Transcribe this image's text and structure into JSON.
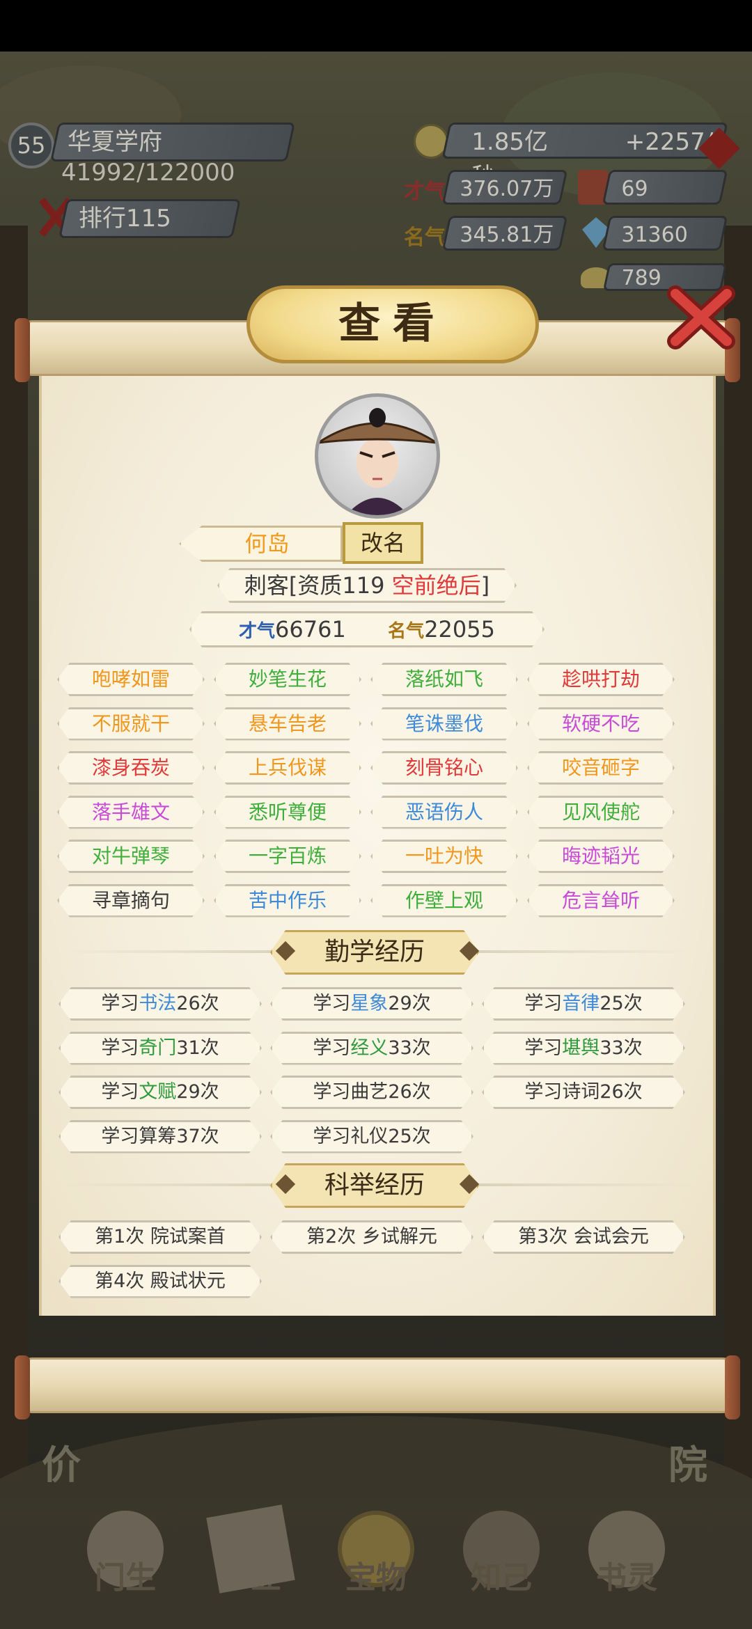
{
  "hud": {
    "level": "55",
    "academy_name": "华夏学府",
    "exp": "41992/122000",
    "rank_label": "排行",
    "rank_value": "115",
    "gold": "1.85亿",
    "gold_rate": "+2257/秒",
    "talent_label": "才气",
    "talent_value": "376.07万",
    "books_value": "69",
    "fame_label": "名气",
    "fame_value": "345.81万",
    "gem_value": "31360",
    "ingot_value": "789",
    "side_left": "价",
    "side_right": "院"
  },
  "dialog": {
    "title": "查看",
    "character": {
      "name": "何岛",
      "rename_label": "改名",
      "profession_prefix": "刺客[资质119 ",
      "grade": "空前绝后",
      "profession_suffix": "]",
      "talent_icon": "才气",
      "talent": "66761",
      "fame_icon": "名气",
      "fame": "22055"
    },
    "traits": [
      {
        "label": "咆哮如雷",
        "color": "#f0971e"
      },
      {
        "label": "妙笔生花",
        "color": "#3fae3a"
      },
      {
        "label": "落纸如飞",
        "color": "#3fae3a"
      },
      {
        "label": "趁哄打劫",
        "color": "#e0393a"
      },
      {
        "label": "不服就干",
        "color": "#f0971e"
      },
      {
        "label": "悬车告老",
        "color": "#f0971e"
      },
      {
        "label": "笔诛墨伐",
        "color": "#3e8ad6"
      },
      {
        "label": "软硬不吃",
        "color": "#c84bd6"
      },
      {
        "label": "漆身吞炭",
        "color": "#e0393a"
      },
      {
        "label": "上兵伐谋",
        "color": "#f0971e"
      },
      {
        "label": "刻骨铭心",
        "color": "#e0393a"
      },
      {
        "label": "咬音砸字",
        "color": "#f0971e"
      },
      {
        "label": "落手雄文",
        "color": "#c84bd6"
      },
      {
        "label": "悉听尊便",
        "color": "#3fae3a"
      },
      {
        "label": "恶语伤人",
        "color": "#3e8ad6"
      },
      {
        "label": "见风使舵",
        "color": "#3fae3a"
      },
      {
        "label": "对牛弹琴",
        "color": "#3fae3a"
      },
      {
        "label": "一字百炼",
        "color": "#3fae3a"
      },
      {
        "label": "一吐为快",
        "color": "#f0971e"
      },
      {
        "label": "晦迹韬光",
        "color": "#c84bd6"
      },
      {
        "label": "寻章摘句",
        "color": "#3a3a3a"
      },
      {
        "label": "苦中作乐",
        "color": "#3e8ad6"
      },
      {
        "label": "作壁上观",
        "color": "#3fae3a"
      },
      {
        "label": "危言耸听",
        "color": "#c84bd6"
      }
    ],
    "study_title": "勤学经历",
    "study": [
      {
        "pre": "学习",
        "subject": "书法",
        "count": "26次",
        "color": "#3e8ad6"
      },
      {
        "pre": "学习",
        "subject": "星象",
        "count": "29次",
        "color": "#3e8ad6"
      },
      {
        "pre": "学习",
        "subject": "音律",
        "count": "25次",
        "color": "#3e8ad6"
      },
      {
        "pre": "学习",
        "subject": "奇门",
        "count": "31次",
        "color": "#2f9a3b"
      },
      {
        "pre": "学习",
        "subject": "经义",
        "count": "33次",
        "color": "#2f9a3b"
      },
      {
        "pre": "学习",
        "subject": "堪舆",
        "count": "33次",
        "color": "#2f9a3b"
      },
      {
        "pre": "学习",
        "subject": "文赋",
        "count": "29次",
        "color": "#2f9a3b"
      },
      {
        "pre": "学习",
        "subject": "曲艺",
        "count": "26次",
        "color": "#3a3a3a"
      },
      {
        "pre": "学习",
        "subject": "诗词",
        "count": "26次",
        "color": "#3a3a3a"
      },
      {
        "pre": "学习",
        "subject": "算筹",
        "count": "37次",
        "color": "#3a3a3a"
      },
      {
        "pre": "学习",
        "subject": "礼仪",
        "count": "25次",
        "color": "#3a3a3a"
      }
    ],
    "exam_title": "科举经历",
    "exams": [
      {
        "label": "第1次 院试案首"
      },
      {
        "label": "第2次 乡试解元"
      },
      {
        "label": "第3次 会试会元"
      },
      {
        "label": "第4次 殿试状元"
      }
    ]
  },
  "nav": [
    {
      "label": "门生"
    },
    {
      "label": "产业"
    },
    {
      "label": "宝物"
    },
    {
      "label": "知己"
    },
    {
      "label": "书灵"
    }
  ]
}
